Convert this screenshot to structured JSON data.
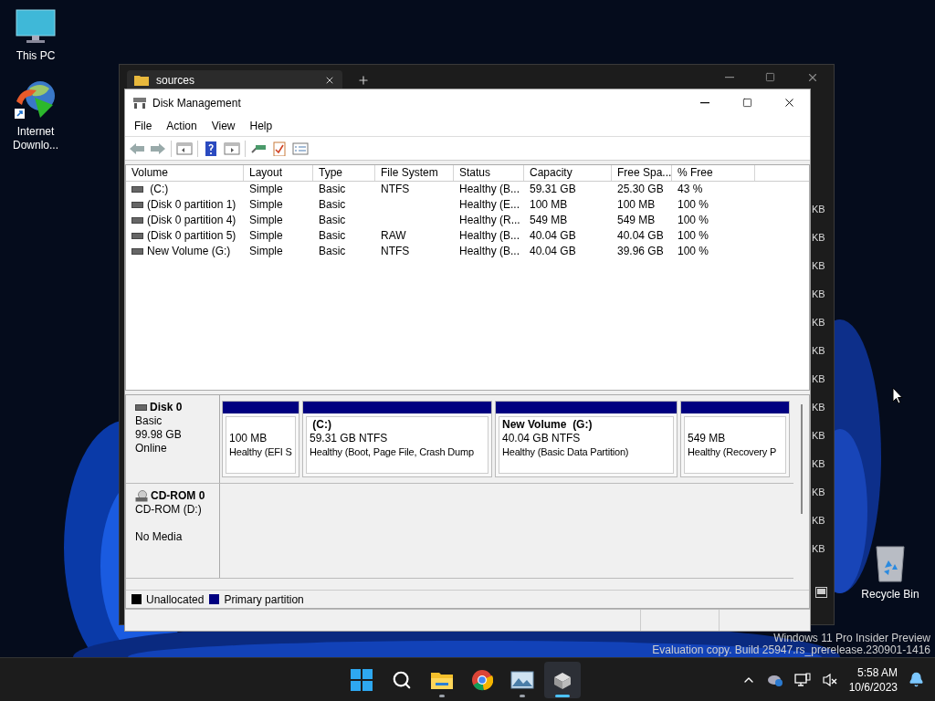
{
  "desktop_icons": [
    {
      "label": "This PC",
      "kind": "pc"
    },
    {
      "label": "Internet Downlo...",
      "kind": "downloader"
    }
  ],
  "recycle_bin": {
    "label": "Recycle Bin"
  },
  "background_window": {
    "tab": "sources",
    "size_cells": [
      "KB",
      "KB",
      "KB",
      "KB",
      "KB",
      "KB",
      "KB",
      "KB",
      "KB",
      "KB",
      "KB",
      "KB",
      "KB"
    ]
  },
  "disk_management": {
    "title": "Disk Management",
    "menu": [
      "File",
      "Action",
      "View",
      "Help"
    ],
    "columns": [
      "Volume",
      "Layout",
      "Type",
      "File System",
      "Status",
      "Capacity",
      "Free Spa...",
      "% Free"
    ],
    "rows": [
      {
        "volume": " (C:)",
        "layout": "Simple",
        "type": "Basic",
        "file_system": "NTFS",
        "status": "Healthy (B...",
        "capacity": "59.31 GB",
        "free_space": "25.30 GB",
        "percent_free": "43 %"
      },
      {
        "volume": "(Disk 0 partition 1)",
        "layout": "Simple",
        "type": "Basic",
        "status": "Healthy (E...",
        "capacity": "100 MB",
        "free_space": "100 MB",
        "percent_free": "100 %"
      },
      {
        "volume": "(Disk 0 partition 4)",
        "layout": "Simple",
        "type": "Basic",
        "status": "Healthy (R...",
        "capacity": "549 MB",
        "free_space": "549 MB",
        "percent_free": "100 %"
      },
      {
        "volume": "(Disk 0 partition 5)",
        "layout": "Simple",
        "type": "Basic",
        "file_system": "RAW",
        "status": "Healthy (B...",
        "capacity": "40.04 GB",
        "free_space": "40.04 GB",
        "percent_free": "100 %"
      },
      {
        "volume": "New Volume (G:)",
        "layout": "Simple",
        "type": "Basic",
        "file_system": "NTFS",
        "status": "Healthy (B...",
        "capacity": "40.04 GB",
        "free_space": "39.96 GB",
        "percent_free": "100 %"
      }
    ],
    "disks": [
      {
        "kind": "disk",
        "name": "Disk 0",
        "type_line": "Basic",
        "size_line": "99.98 GB",
        "status_line": "Online",
        "partitions": [
          {
            "size": "100 MB",
            "status": "Healthy (EFI S"
          },
          {
            "label": " (C:)",
            "size": "59.31 GB NTFS",
            "status": "Healthy (Boot, Page File, Crash Dump"
          },
          {
            "label": "New Volume  (G:)",
            "size": "40.04 GB NTFS",
            "status": "Healthy (Basic Data Partition)"
          },
          {
            "size": "549 MB",
            "status": "Healthy (Recovery P"
          }
        ]
      },
      {
        "kind": "cdrom",
        "name": "CD-ROM 0",
        "type_line": "CD-ROM (D:)",
        "status_line": "No Media"
      }
    ],
    "legend": [
      {
        "label": "Unallocated",
        "color": "#000000"
      },
      {
        "label": "Primary partition",
        "color": "#000080"
      }
    ]
  },
  "watermark": [
    "Windows 11 Pro Insider Preview",
    "Evaluation copy. Build 25947.rs_prerelease.230901-1416"
  ],
  "taskbar": {
    "apps": [
      {
        "kind": "start",
        "running": false,
        "selected": false
      },
      {
        "kind": "search",
        "running": false,
        "selected": false
      },
      {
        "kind": "explorer",
        "running": true,
        "selected": false
      },
      {
        "kind": "chrome",
        "running": false,
        "selected": false
      },
      {
        "kind": "photos",
        "running": true,
        "selected": false
      },
      {
        "kind": "diskmgmt",
        "running": true,
        "selected": true
      }
    ],
    "time": "5:58 AM",
    "date": "10/6/2023"
  }
}
